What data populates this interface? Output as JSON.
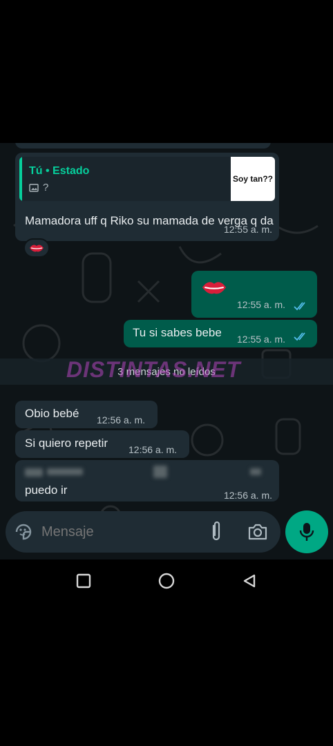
{
  "status_message": {
    "quote_title": "Tú • Estado",
    "quote_sub": "?",
    "thumb_text": "Soy tan??",
    "text": "Mamadora uff q Riko su mamada de verga q da",
    "time": "12:55 a. m.",
    "reaction": "lips-emoji"
  },
  "sent_messages": [
    {
      "content": "lips-emoji",
      "time": "12:55 a. m."
    },
    {
      "text": "Tu si sabes bebe",
      "time": "12:55 a. m."
    }
  ],
  "unread_banner": "3 mensajes no leídos",
  "watermark": "DISTINTAS.NET",
  "received_messages": [
    {
      "text": "Obio bebé",
      "time": "12:56 a. m."
    },
    {
      "text": "Si quiero repetir",
      "time": "12:56 a. m."
    },
    {
      "text_partial_end": "puedo ir",
      "time": "12:56 a. m."
    }
  ],
  "input": {
    "placeholder": "Mensaje"
  },
  "colors": {
    "chat_bg": "#0e1417",
    "incoming": "#1f2c34",
    "outgoing": "#005c4b",
    "accent": "#00a884",
    "read_ticks": "#53bdeb"
  },
  "icons": [
    "sticker-icon",
    "attach-icon",
    "camera-icon",
    "mic-icon",
    "recent-apps-icon",
    "home-icon",
    "back-icon"
  ]
}
